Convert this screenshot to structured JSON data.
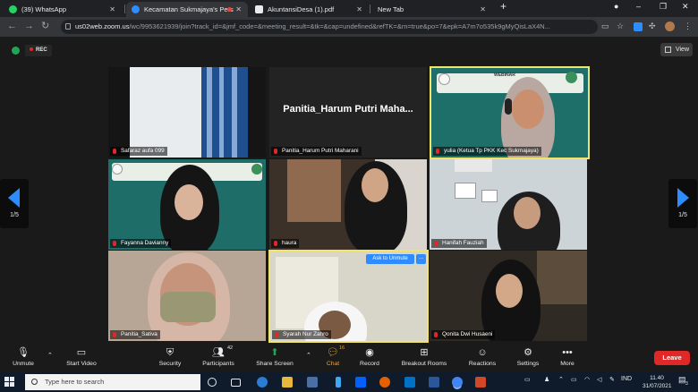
{
  "browser": {
    "tabs": [
      {
        "label": "(39) WhatsApp",
        "color": "#25d366"
      },
      {
        "label": "Kecamatan Sukmajaya's Pers",
        "color": "#2d8cff"
      },
      {
        "label": "AkuntansiDesa (1).pdf",
        "color": "#e8eaed"
      },
      {
        "label": "New Tab",
        "color": "#e8eaed"
      }
    ],
    "new_tab_glyph": "+",
    "url_host": "us02web.zoom.us",
    "url_path": "/wc/9953621939/join?track_id=&jmf_code=&meeting_result=&tk=&cap=undefined&refTK=&rn=true&po=7&epk=A7m7o535k9gMyQisLaX4N..."
  },
  "meeting": {
    "rec_label": "REC",
    "view_label": "View",
    "page_left": "1/5",
    "page_right": "1/5"
  },
  "tiles": [
    {
      "name": "Safaraz aufa 099"
    },
    {
      "name": "Panitia_Harum Putri Maharani",
      "big_name": "Panitia_Harum Putri Maha..."
    },
    {
      "name": "yulia (Ketua Tp PKK Kec Sukmajaya)",
      "banner": "WEBINAR"
    },
    {
      "name": "Fayanna Davianny"
    },
    {
      "name": "haura"
    },
    {
      "name": "Hanifah Fauziah"
    },
    {
      "name": "Panitia_Sativa"
    },
    {
      "name": "Syarah Nur Zahro",
      "ask_label": "Ask to Unmute",
      "more_label": "..."
    },
    {
      "name": "Qonita Dwi Husaeni"
    }
  ],
  "controls": {
    "unmute": "Unmute",
    "start_video": "Start Video",
    "security": "Security",
    "participants": "Participants",
    "participants_count": "42",
    "share_screen": "Share Screen",
    "chat": "Chat",
    "chat_badge": "16",
    "record": "Record",
    "breakout_rooms": "Breakout Rooms",
    "reactions": "Reactions",
    "settings": "Settings",
    "more": "More",
    "leave": "Leave"
  },
  "taskbar": {
    "search_placeholder": "Type here to search",
    "lang": "IND",
    "time": "11.40",
    "date": "31/07/2021",
    "notif_count": "3"
  },
  "colors": {
    "accent": "#2d8cff",
    "leave": "#e02828",
    "chat_active": "#e8a33a",
    "share": "#23a455"
  }
}
